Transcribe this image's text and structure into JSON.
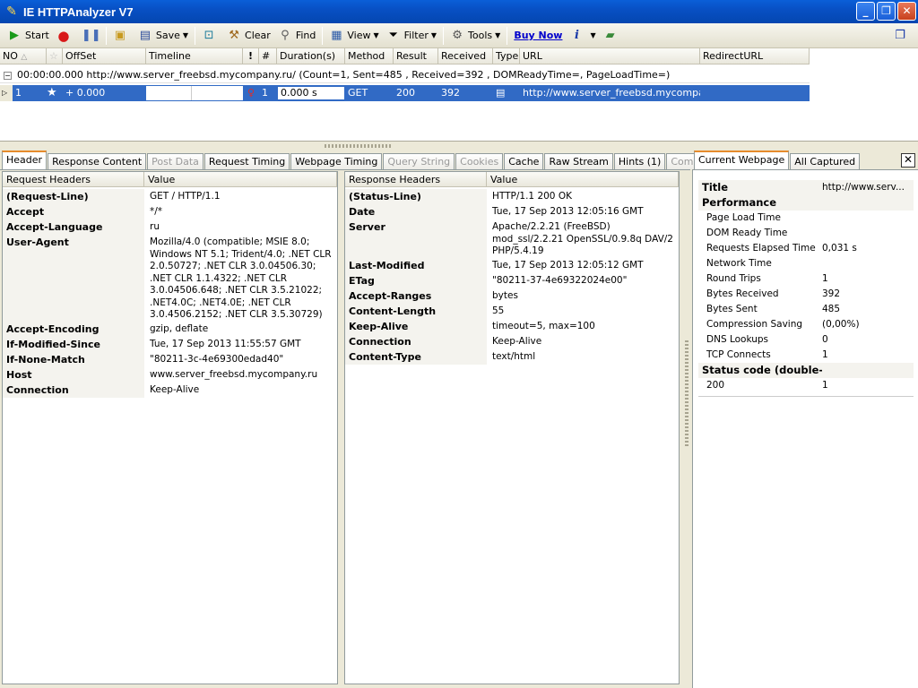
{
  "window": {
    "title": "IE HTTPAnalyzer V7"
  },
  "toolbar": {
    "start": "Start",
    "save": "Save",
    "clear": "Clear",
    "find": "Find",
    "view": "View",
    "filter": "Filter",
    "tools": "Tools",
    "buy_now": "Buy Now"
  },
  "grid": {
    "columns": [
      "NO",
      "OffSet",
      "Timeline",
      "!",
      "#",
      "Duration(s)",
      "Method",
      "Result",
      "Received",
      "Type",
      "URL",
      "RedirectURL"
    ],
    "group_row": "00:00:00.000  http://www.server_freebsd.mycompany.ru/  (Count=1, Sent=485 , Received=392 , DOMReadyTime=, PageLoadTime=)",
    "row": {
      "no": "1",
      "offset": "+ 0.000",
      "count": "1",
      "duration": "0.000 s",
      "method": "GET",
      "result": "200",
      "received": "392",
      "url": "http://www.server_freebsd.mycompany..."
    }
  },
  "tabs": [
    {
      "label": "Header",
      "state": "active"
    },
    {
      "label": "Response Content",
      "state": "normal"
    },
    {
      "label": "Post Data",
      "state": "disabled"
    },
    {
      "label": "Request Timing",
      "state": "normal"
    },
    {
      "label": "Webpage Timing",
      "state": "normal"
    },
    {
      "label": "Query String",
      "state": "disabled"
    },
    {
      "label": "Cookies",
      "state": "disabled"
    },
    {
      "label": "Cache",
      "state": "normal"
    },
    {
      "label": "Raw Stream",
      "state": "normal"
    },
    {
      "label": "Hints (1)",
      "state": "normal"
    },
    {
      "label": "Comment",
      "state": "disabled"
    }
  ],
  "request": {
    "head_key": "Request Headers",
    "head_value": "Value",
    "rows": [
      {
        "k": "(Request-Line)",
        "v": "GET / HTTP/1.1"
      },
      {
        "k": "Accept",
        "v": "*/*"
      },
      {
        "k": "Accept-Language",
        "v": "ru"
      },
      {
        "k": "User-Agent",
        "v": "Mozilla/4.0 (compatible; MSIE 8.0; Windows NT 5.1; Trident/4.0; .NET CLR 2.0.50727; .NET CLR 3.0.04506.30; .NET CLR 1.1.4322; .NET CLR 3.0.04506.648; .NET CLR 3.5.21022; .NET4.0C; .NET4.0E; .NET CLR 3.0.4506.2152; .NET CLR 3.5.30729)"
      },
      {
        "k": "Accept-Encoding",
        "v": "gzip, deflate"
      },
      {
        "k": "If-Modified-Since",
        "v": "Tue, 17 Sep 2013 11:55:57 GMT"
      },
      {
        "k": "If-None-Match",
        "v": "\"80211-3c-4e69300edad40\""
      },
      {
        "k": "Host",
        "v": "www.server_freebsd.mycompany.ru"
      },
      {
        "k": "Connection",
        "v": "Keep-Alive"
      }
    ]
  },
  "response": {
    "head_key": "Response Headers",
    "head_value": "Value",
    "rows": [
      {
        "k": "(Status-Line)",
        "v": "HTTP/1.1 200 OK"
      },
      {
        "k": "Date",
        "v": "Tue, 17 Sep 2013 12:05:16 GMT"
      },
      {
        "k": "Server",
        "v": "Apache/2.2.21 (FreeBSD) mod_ssl/2.2.21 OpenSSL/0.9.8q DAV/2 PHP/5.4.19"
      },
      {
        "k": "Last-Modified",
        "v": "Tue, 17 Sep 2013 12:05:12 GMT"
      },
      {
        "k": "ETag",
        "v": "\"80211-37-4e69322024e00\""
      },
      {
        "k": "Accept-Ranges",
        "v": "bytes"
      },
      {
        "k": "Content-Length",
        "v": "55"
      },
      {
        "k": "Keep-Alive",
        "v": "timeout=5, max=100"
      },
      {
        "k": "Connection",
        "v": "Keep-Alive"
      },
      {
        "k": "Content-Type",
        "v": "text/html"
      }
    ]
  },
  "right_tabs": [
    {
      "label": "Current Webpage",
      "state": "active"
    },
    {
      "label": "All Captured",
      "state": "normal"
    }
  ],
  "summary": [
    {
      "k": "Title",
      "v": "http://www.serv...",
      "type": "sec"
    },
    {
      "k": "Performance",
      "v": "",
      "type": "sec"
    },
    {
      "k": "Page Load Time",
      "v": "",
      "type": "item"
    },
    {
      "k": "DOM Ready Time",
      "v": "",
      "type": "item"
    },
    {
      "k": "Requests Elapsed Time",
      "v": "0,031 s",
      "type": "item"
    },
    {
      "k": "Network Time",
      "v": "",
      "type": "item"
    },
    {
      "k": "Round Trips",
      "v": "1",
      "type": "item"
    },
    {
      "k": "Bytes Received",
      "v": "392",
      "type": "item"
    },
    {
      "k": "Bytes Sent",
      "v": "485",
      "type": "item"
    },
    {
      "k": "Compression Saving",
      "v": " (0,00%)",
      "type": "item"
    },
    {
      "k": "DNS Lookups",
      "v": "0",
      "type": "item"
    },
    {
      "k": "TCP Connects",
      "v": "1",
      "type": "item"
    },
    {
      "k": "Status code (double-...",
      "v": "",
      "type": "sec"
    },
    {
      "k": "200",
      "v": "1",
      "type": "item"
    }
  ],
  "colors": {
    "selection": "#316ac5",
    "title_bar": "#0850c4",
    "active_tab_accent": "#e68b2c"
  }
}
